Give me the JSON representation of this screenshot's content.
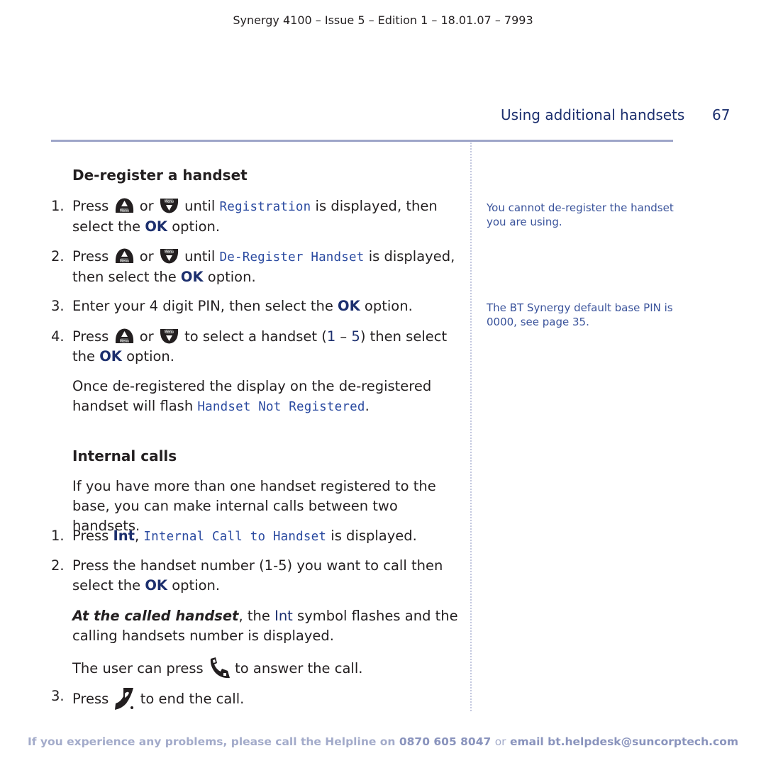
{
  "header": {
    "doc_info": "Synergy 4100 – Issue 5 – Edition 1 – 18.01.07 – 7993",
    "section_title": "Using additional handsets",
    "page_number": "67"
  },
  "deregister": {
    "heading": "De-register a handset",
    "steps": [
      {
        "num": "1.",
        "press": "Press",
        "or": "or",
        "until": "until",
        "lcd": "Registration",
        "rest1": "is displayed, then select the",
        "ok": "OK",
        "rest2": "option."
      },
      {
        "num": "2.",
        "press": "Press",
        "or": "or",
        "until": "until",
        "lcd": "De-Register Handset",
        "rest1": "is displayed, then select the",
        "ok": "OK",
        "rest2": "option."
      },
      {
        "num": "3.",
        "text": "Enter your 4 digit PIN, then select the",
        "ok": "OK",
        "rest2": "option."
      },
      {
        "num": "4.",
        "press": "Press",
        "or": "or",
        "text1": "to select a handset (",
        "range_start": "1",
        "dash": " – ",
        "range_end": "5",
        "text2": ") then select the",
        "ok": "OK",
        "rest2": "option."
      }
    ],
    "note_text": "Once de-registered the display on the de-registered handset will flash",
    "note_lcd": "Handset Not Registered",
    "note_end": "."
  },
  "internal": {
    "heading": "Internal calls",
    "intro": "If you have more than one handset registered to the base, you can make internal calls between two handsets.",
    "steps": [
      {
        "num": "1.",
        "press": "Press",
        "int": "Int",
        "comma": ",",
        "lcd": "Internal Call to Handset",
        "rest": "is displayed."
      },
      {
        "num": "2.",
        "text": "Press the handset number (1-5) you want to call then select the",
        "ok": "OK",
        "rest2": "option."
      },
      {
        "num": "3.",
        "press": "Press",
        "rest": "to end the call."
      }
    ],
    "called_bold": "At the called handset",
    "called_text1": ", the",
    "called_int": "Int",
    "called_text2": "symbol flashes and the calling handsets number is displayed.",
    "answer_text1": "The user can press",
    "answer_text2": "to answer the call."
  },
  "side_notes": [
    "You cannot de-register the handset you are using.",
    "The BT Synergy default base PIN is 0000, see page 35."
  ],
  "icons": {
    "up_key_label": "Menu",
    "down_key_label": "Menu"
  },
  "footer": {
    "text1": "If you experience any problems, please call the Helpline on",
    "phone": "0870 605 8047",
    "or": "or",
    "email_label": "email bt.helpdesk@suncorptech.com"
  },
  "colors": {
    "accent_navy": "#1c2f6e",
    "lcd_blue": "#2a4aa0",
    "rule": "#9ea6c9",
    "footer": "#a3abca"
  }
}
